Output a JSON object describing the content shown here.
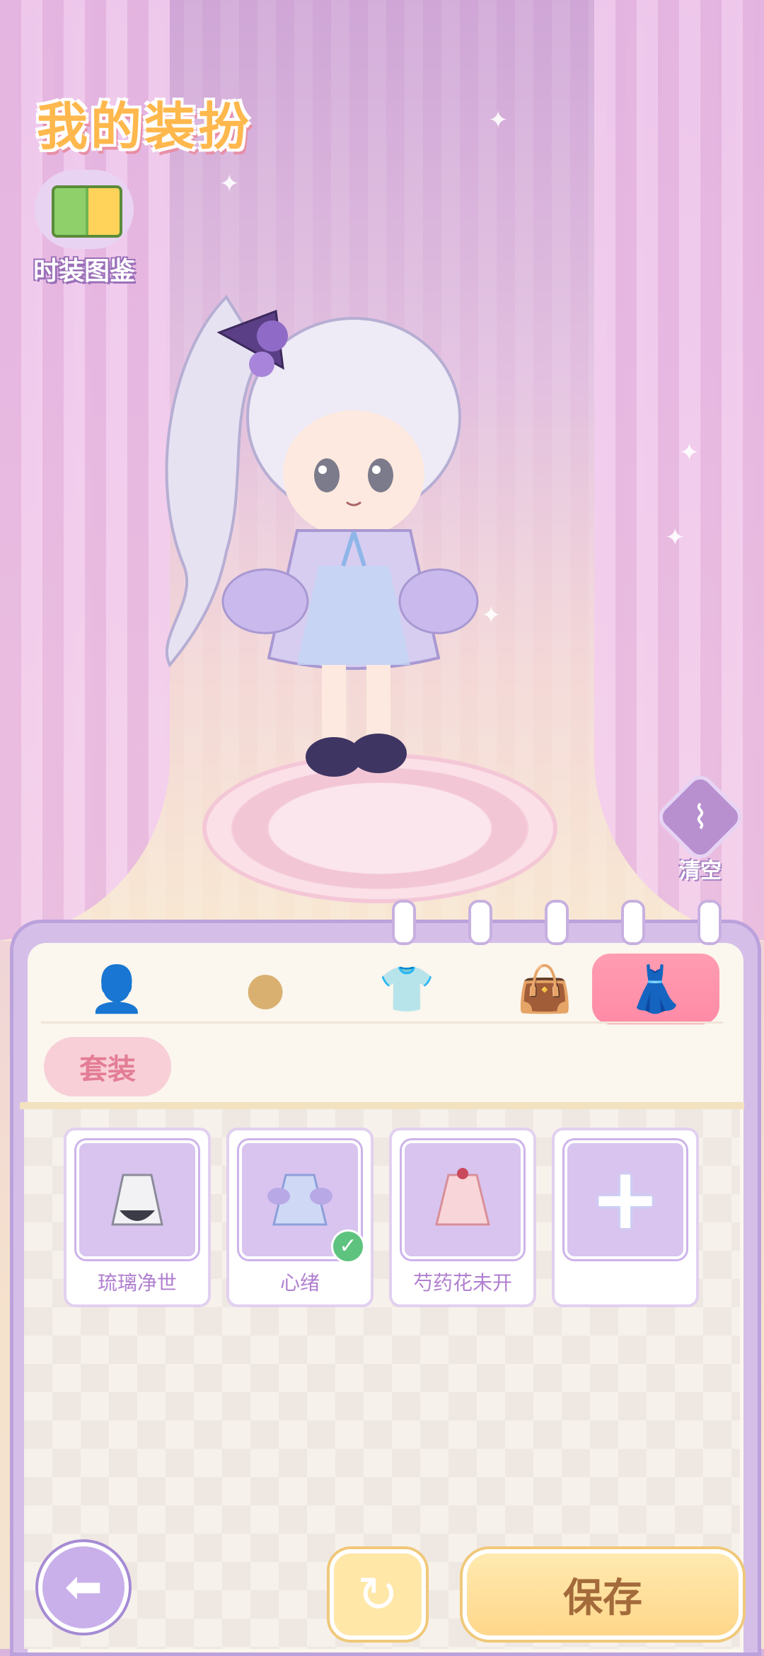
{
  "header": {
    "title": "我的装扮"
  },
  "catalog": {
    "label": "时装图鉴",
    "icon": "book-hanger-icon"
  },
  "side_actions": {
    "clear_label": "清空",
    "clear_icon": "broom-icon"
  },
  "category_tabs": [
    {
      "id": "hair",
      "icon": "hairstyle-icon",
      "active": false
    },
    {
      "id": "face",
      "icon": "face-icon",
      "active": false
    },
    {
      "id": "top",
      "icon": "tshirt-icon",
      "active": false
    },
    {
      "id": "accessory",
      "icon": "handbag-icon",
      "active": false
    },
    {
      "id": "dress",
      "icon": "dress-icon",
      "active": true
    }
  ],
  "sub_tab": {
    "label": "套装"
  },
  "outfits": [
    {
      "name": "琉璃净世",
      "selected": false
    },
    {
      "name": "心绪",
      "selected": true
    },
    {
      "name": "芍药花未开",
      "selected": false
    },
    {
      "name": "",
      "icon": "plus-icon",
      "selected": false
    }
  ],
  "bottom_bar": {
    "back_icon": "arrow-left-icon",
    "refresh_icon": "refresh-icon",
    "save_label": "保存"
  },
  "colors": {
    "accent_pink": "#ff8aa6",
    "panel_purple": "#d5bfe9",
    "gold": "#ffd68a"
  }
}
